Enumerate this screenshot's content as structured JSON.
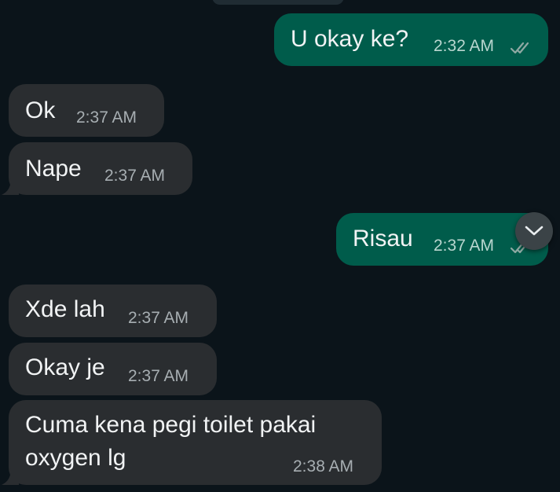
{
  "messages": [
    {
      "direction": "out",
      "text": "U okay ke?",
      "time": "2:32 AM",
      "status": "read-double-check"
    },
    {
      "direction": "in",
      "text": "Ok",
      "time": "2:37 AM"
    },
    {
      "direction": "in",
      "text": "Nape",
      "time": "2:37 AM"
    },
    {
      "direction": "out",
      "text": "Risau",
      "time": "2:37 AM",
      "status": "read-double-check"
    },
    {
      "direction": "in",
      "text": "Xde lah",
      "time": "2:37 AM"
    },
    {
      "direction": "in",
      "text": "Okay je",
      "time": "2:37 AM"
    },
    {
      "direction": "in",
      "text_line1": "Cuma kena pegi toilet pakai",
      "text_line2": "oxygen lg",
      "time": "2:38 AM"
    }
  ],
  "icons": {
    "ticks": "double-check-icon",
    "scroll": "chevron-down-icon"
  },
  "colors": {
    "background": "#0b141a",
    "incoming_bubble": "#2a2d30",
    "outgoing_bubble": "#005c4b",
    "text": "#f1f3f4",
    "timestamp": "#a7aeb2"
  }
}
